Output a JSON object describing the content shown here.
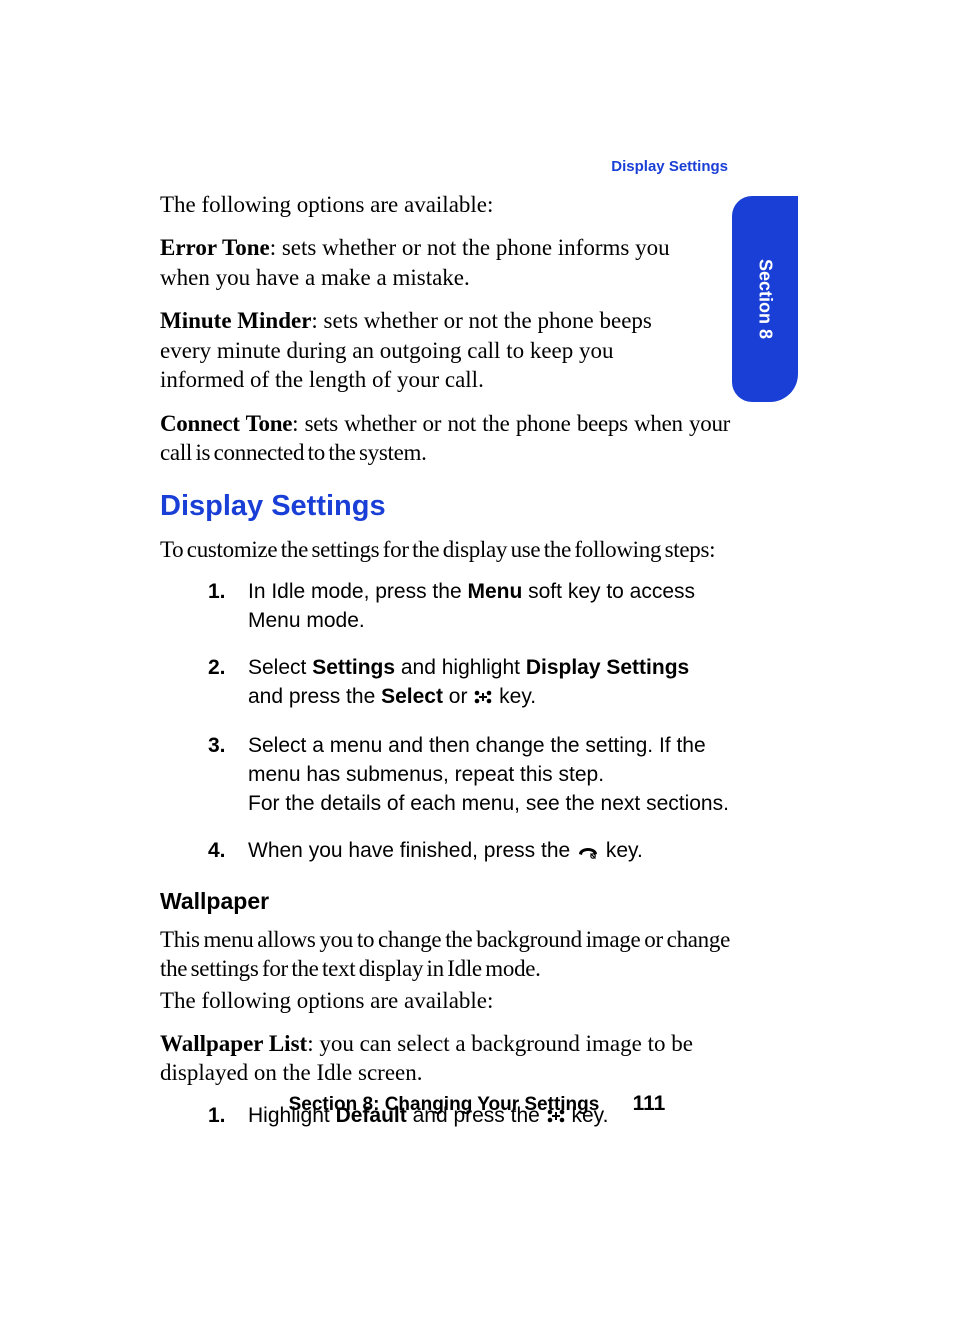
{
  "running_header": "Display Settings",
  "side_tab": "Section 8",
  "intro_available": "The following options are available:",
  "options": {
    "error_tone": {
      "label": "Error Tone",
      "desc": ": sets whether or not the phone informs you when you have a make a mistake."
    },
    "minute_minder": {
      "label": "Minute Minder",
      "desc": ": sets whether or not the phone beeps every minute during an outgoing call to keep you informed of the length of your call."
    },
    "connect_tone": {
      "label": "Connect Tone",
      "desc": ": sets whether or not the phone beeps when your call is connected to the system."
    }
  },
  "section_title": "Display Settings",
  "section_intro": "To customize the settings for the display use the following steps:",
  "steps": [
    {
      "n": "1.",
      "pre": "In Idle mode, press the ",
      "b1": "Menu",
      "post": " soft key to access Menu mode."
    },
    {
      "n": "2.",
      "pre": "Select ",
      "b1": "Settings",
      "mid1": " and highlight ",
      "b2": "Display Settings",
      "mid2": " and press the ",
      "b3": "Select",
      "mid3": " or ",
      "post": " key."
    },
    {
      "n": "3.",
      "pre": "Select a menu and then change the setting. If the menu has submenus, repeat this step.",
      "line2": "For the details of each menu, see the next sections."
    },
    {
      "n": "4.",
      "pre": "When you have finished, press the ",
      "post": " key."
    }
  ],
  "wallpaper": {
    "title": "Wallpaper",
    "para1": "This menu allows you to change the background image or change the settings for the text display in Idle mode.",
    "para2": "The following options are available:",
    "wl_label": "Wallpaper List",
    "wl_desc": ": you can select a background image to be displayed on the Idle screen.",
    "step1": {
      "n": "1.",
      "pre": "Highlight ",
      "b1": "Default",
      "mid": " and press the ",
      "post": " key."
    }
  },
  "footer": {
    "section": "Section 8: Changing Your Settings",
    "page": "111"
  }
}
